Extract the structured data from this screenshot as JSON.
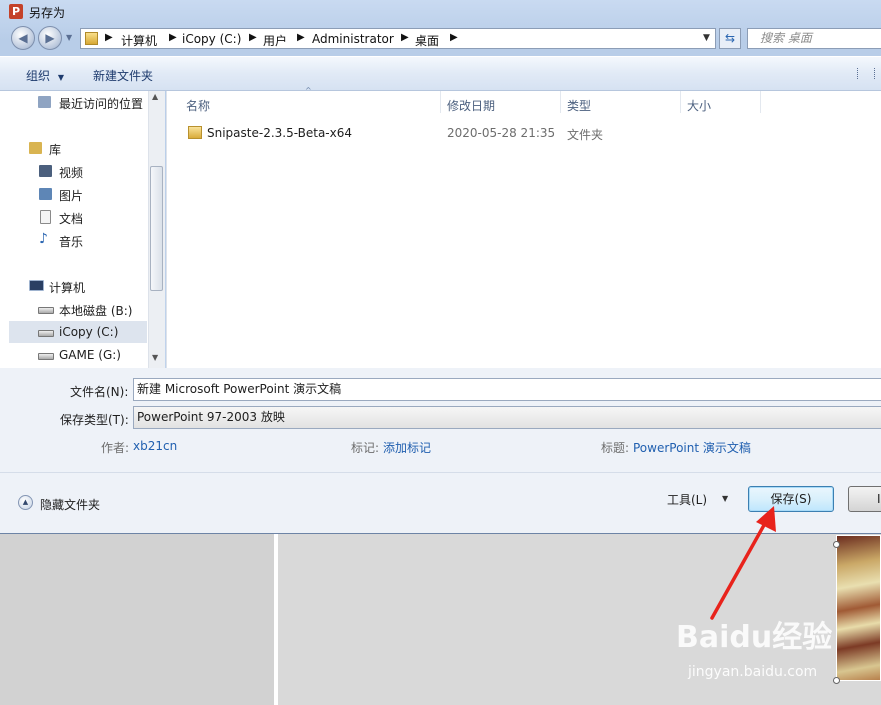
{
  "window": {
    "title": "另存为",
    "app_icon_letter": "P"
  },
  "address": {
    "crumbs": [
      "计算机",
      "iCopy (C:)",
      "用户",
      "Administrator",
      "桌面"
    ],
    "search_placeholder": "搜索 桌面"
  },
  "toolbar": {
    "organize_label": "组织",
    "new_folder_label": "新建文件夹"
  },
  "nav": {
    "recent_label": "最近访问的位置",
    "libraries_label": "库",
    "libraries": [
      "视频",
      "图片",
      "文档",
      "音乐"
    ],
    "computer_label": "计算机",
    "drives": [
      "本地磁盘 (B:)",
      "iCopy (C:)",
      "GAME (G:)"
    ]
  },
  "filelist": {
    "columns": [
      "名称",
      "修改日期",
      "类型",
      "大小"
    ],
    "rows": [
      {
        "name": "Snipaste-2.3.5-Beta-x64",
        "date": "2020-05-28 21:35",
        "type": "文件夹",
        "size": ""
      }
    ]
  },
  "form": {
    "filename_label": "文件名(N):",
    "filename_value": "新建 Microsoft PowerPoint 演示文稿",
    "filetype_label": "保存类型(T):",
    "filetype_value": "PowerPoint 97-2003 放映",
    "author_label": "作者:",
    "author_value": "xb21cn",
    "tags_label": "标记:",
    "tags_value": "添加标记",
    "title_label": "标题:",
    "title_value": "PowerPoint 演示文稿"
  },
  "footer": {
    "hide_folders_label": "隐藏文件夹",
    "tools_label": "工具(L)",
    "save_label": "保存(S)",
    "cancel_label": "I"
  },
  "watermark": {
    "brand": "Baidu经验",
    "url": "jingyan.baidu.com"
  },
  "colors": {
    "accent_link": "#2160b0",
    "arrow": "#e8231c",
    "save_border": "#3c7fb1"
  }
}
